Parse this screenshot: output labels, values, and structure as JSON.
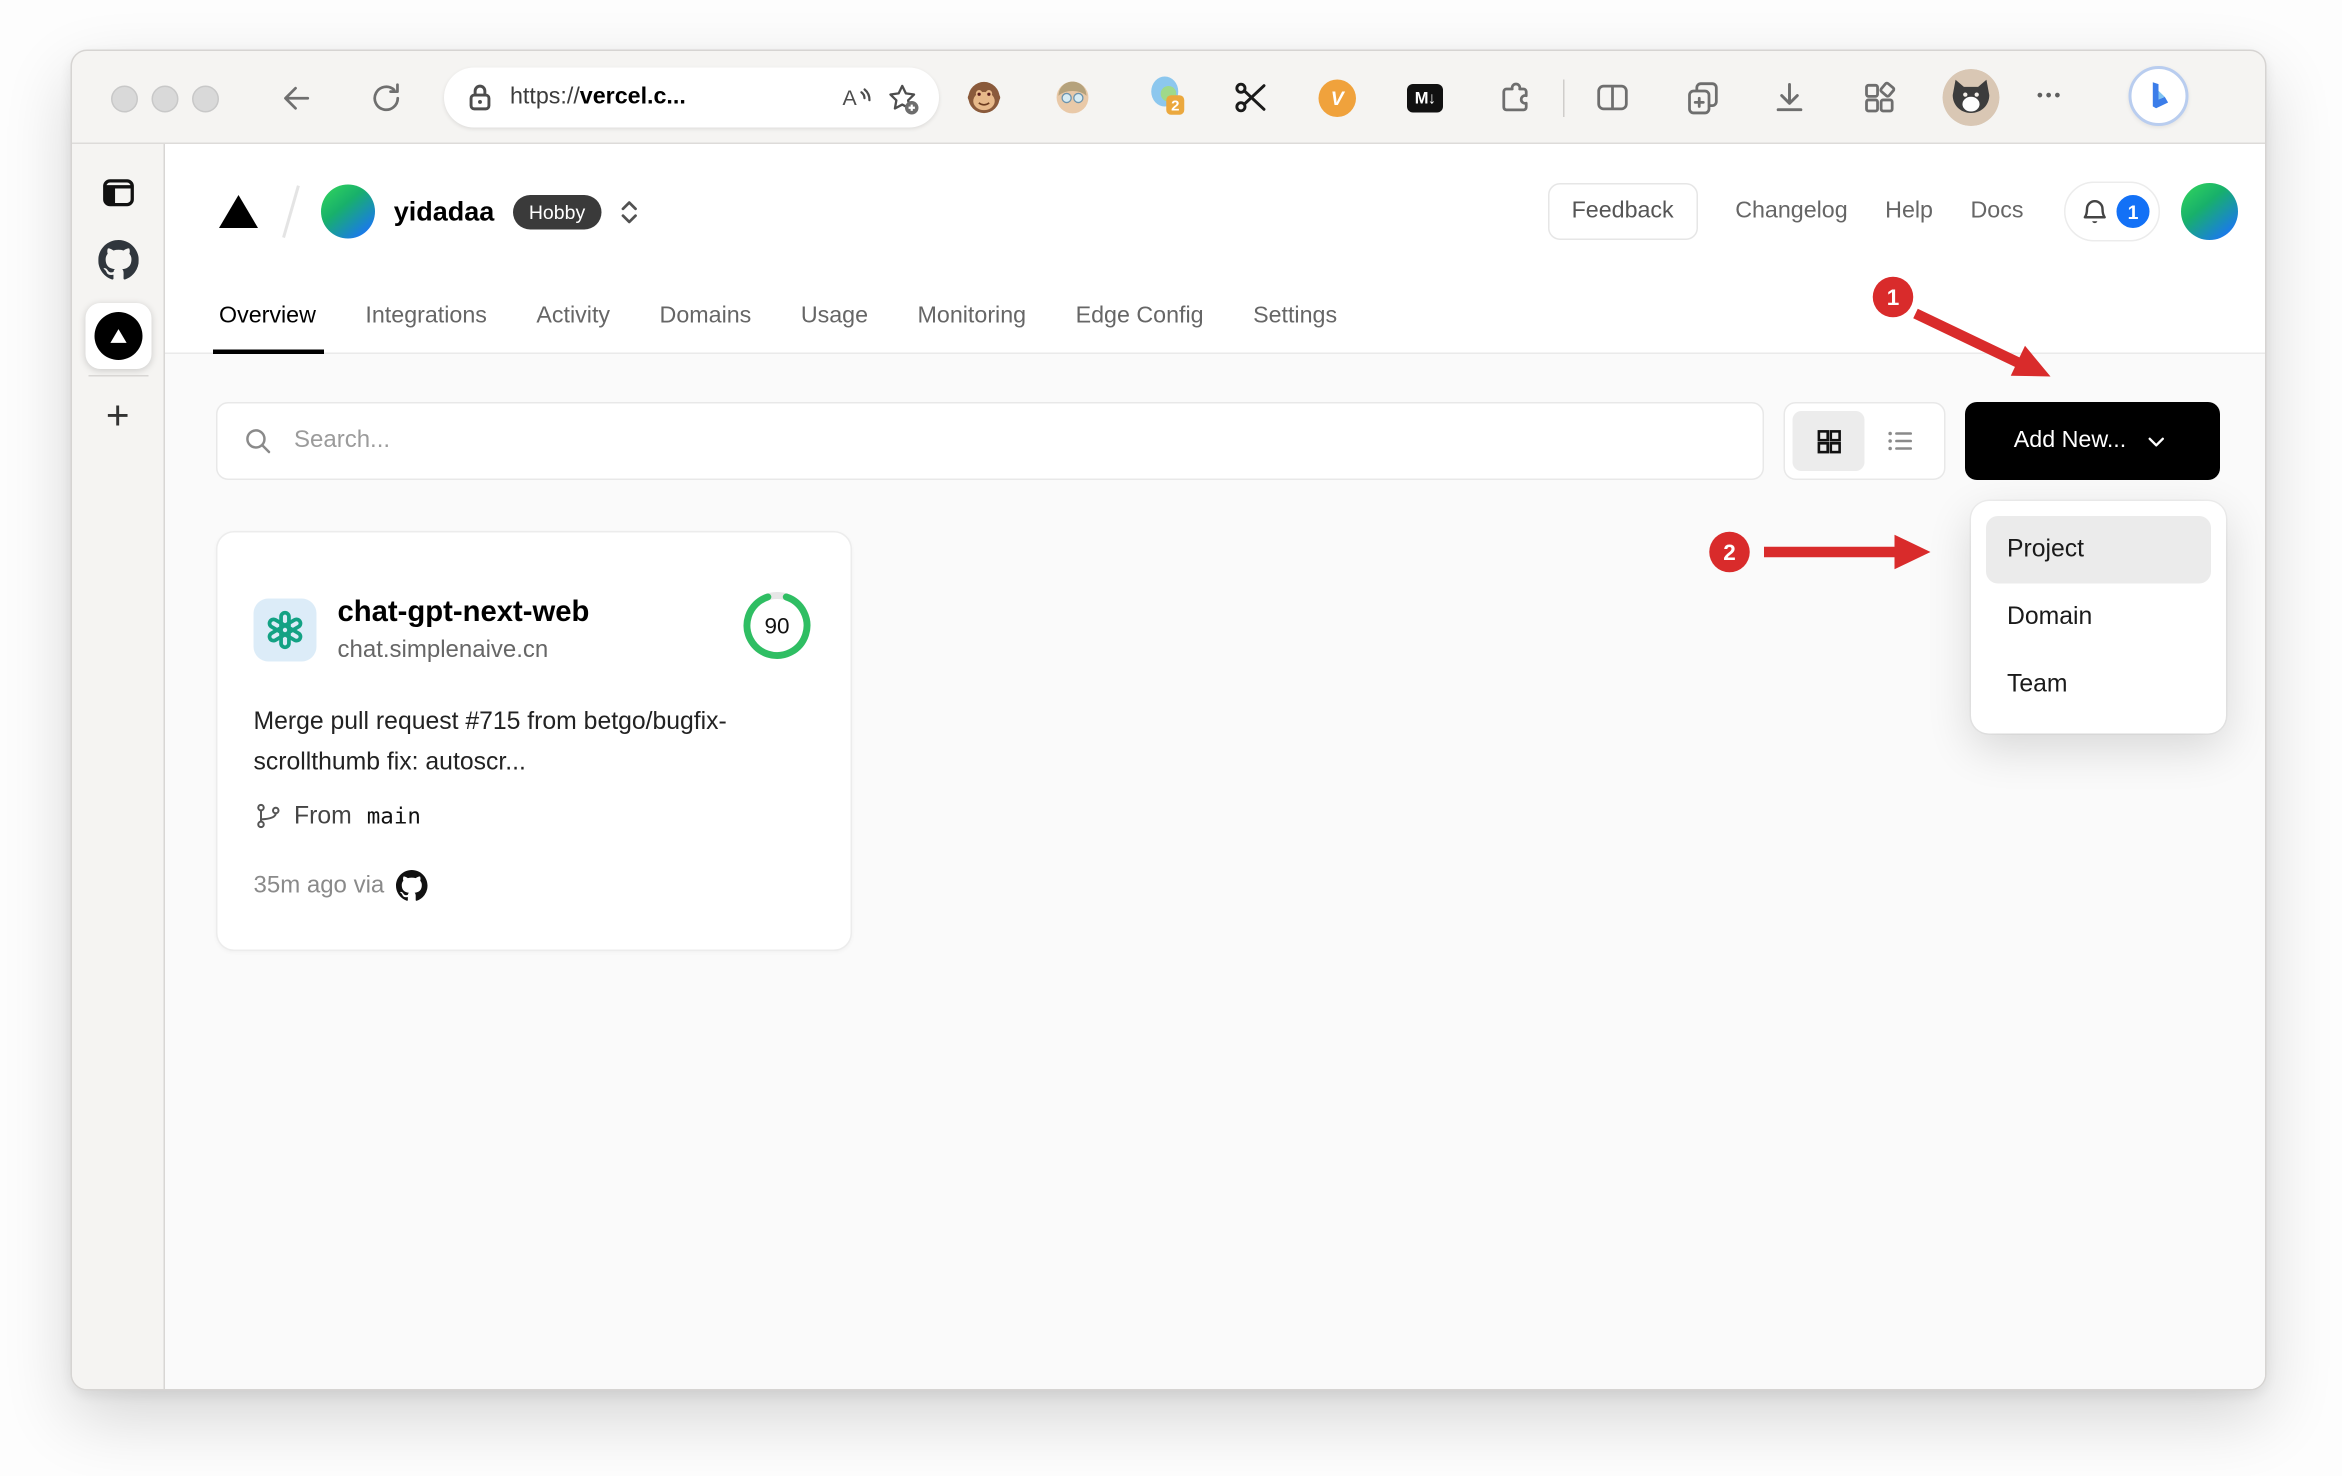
{
  "browser": {
    "url_scheme": "https://",
    "url_host": "vercel.c...",
    "extensions": {
      "tab_group_badge": "2",
      "video_label": "V",
      "markdown_label": "M↓"
    },
    "menu_dots": "•••",
    "bing_label": "b"
  },
  "app_sidebar": {
    "plus_label": "+"
  },
  "vercel": {
    "team_name": "yidadaa",
    "plan_badge": "Hobby",
    "nav_links": {
      "feedback": "Feedback",
      "changelog": "Changelog",
      "help": "Help",
      "docs": "Docs"
    },
    "notification_count": "1",
    "tabs": [
      {
        "label": "Overview",
        "active": true
      },
      {
        "label": "Integrations",
        "active": false
      },
      {
        "label": "Activity",
        "active": false
      },
      {
        "label": "Domains",
        "active": false
      },
      {
        "label": "Usage",
        "active": false
      },
      {
        "label": "Monitoring",
        "active": false
      },
      {
        "label": "Edge Config",
        "active": false
      },
      {
        "label": "Settings",
        "active": false
      }
    ],
    "controls": {
      "search_placeholder": "Search...",
      "add_new_label": "Add New..."
    },
    "add_menu": {
      "items": [
        "Project",
        "Domain",
        "Team"
      ],
      "highlighted_item": "Project"
    },
    "project_card": {
      "name": "chat-gpt-next-web",
      "domain": "chat.simplenaive.cn",
      "score": "90",
      "commit_message": "Merge pull request #715 from betgo/bugfix-scrollthumb fix: autoscr...",
      "branch_prefix": "From",
      "branch_name": "main",
      "deployed_meta": "35m ago via"
    }
  },
  "annotations": {
    "step1": "1",
    "step2": "2",
    "color": "#d92b2b"
  },
  "colors": {
    "accent_blue": "#1371f6",
    "score_green": "#2fbe63",
    "openai_teal": "#13a284",
    "annotation_red": "#d92b2b"
  }
}
